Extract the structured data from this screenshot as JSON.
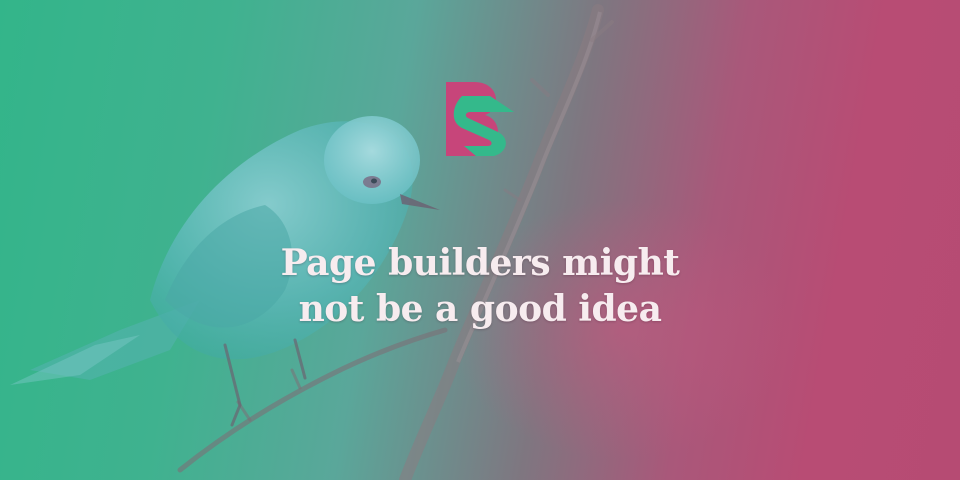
{
  "headline": {
    "line1": "Page builders might",
    "line2": "not be a good idea"
  },
  "logo": {
    "icon": "brand-logo-icon",
    "primary_color": "#c7457a",
    "secondary_color": "#34b98b"
  },
  "colors": {
    "gradient_left": "#33b58a",
    "gradient_right": "#b64b73",
    "headline_text": "#f7ecef"
  }
}
